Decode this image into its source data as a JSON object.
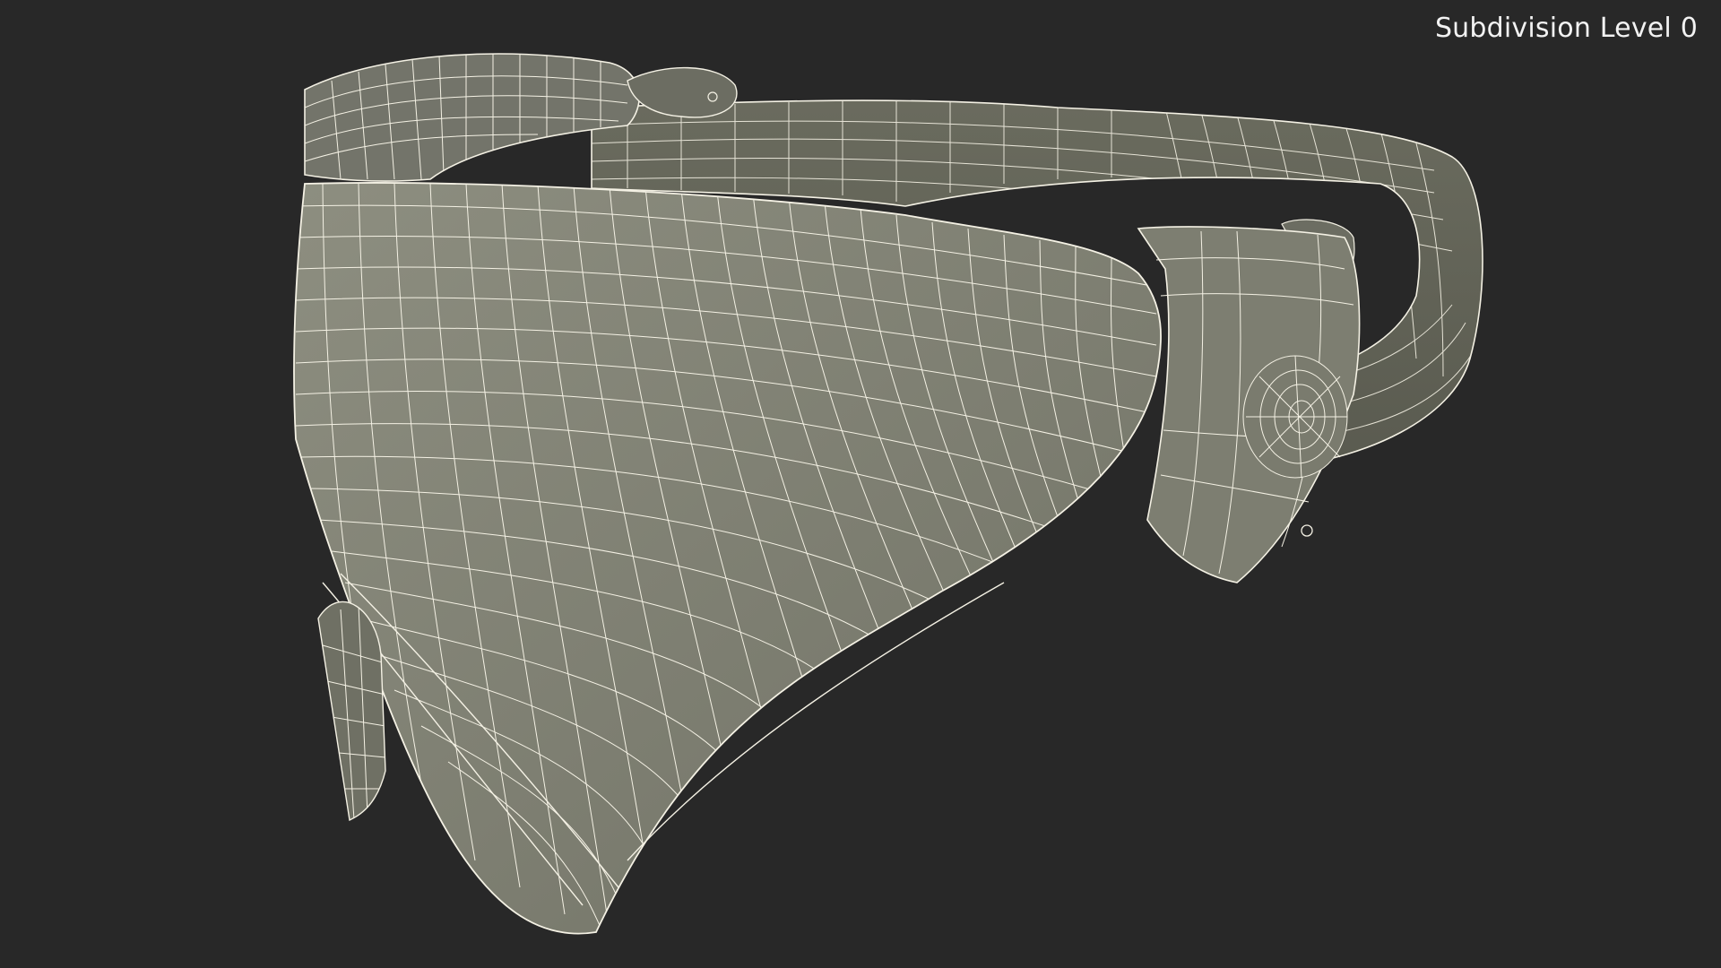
{
  "viewport": {
    "background_color": "#282828",
    "overlay_label": "Subdivision Level 0",
    "overlay_label_color": "#f2f2f2"
  },
  "model": {
    "render_style": "wireframe-on-shaded",
    "surface_color": "#838476",
    "surface_dark_color": "#5f6054",
    "surface_light_color": "#9a9b8c",
    "wire_color": "#f4f1e4"
  }
}
